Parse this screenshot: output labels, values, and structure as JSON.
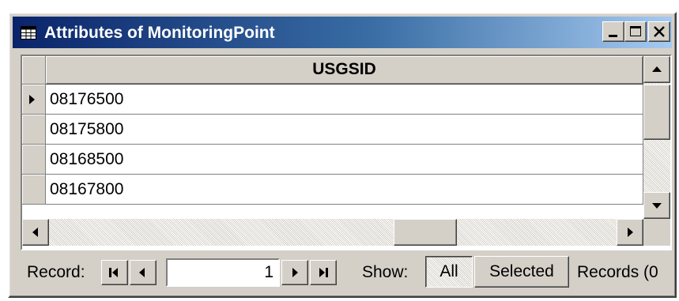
{
  "window": {
    "title": "Attributes of MonitoringPoint",
    "icon": "table-icon",
    "controls": {
      "minimize_icon": "minimize-icon",
      "maximize_icon": "maximize-icon",
      "close_icon": "close-icon"
    }
  },
  "table": {
    "column_header": "USGSID",
    "rows": [
      "08176500",
      "08175800",
      "08168500",
      "08167800"
    ],
    "current_row_icon": "row-pointer-icon"
  },
  "statusbar": {
    "record_label": "Record:",
    "record_value": "1",
    "first_icon": "first-record-icon",
    "prev_icon": "previous-record-icon",
    "next_icon": "next-record-icon",
    "last_icon": "last-record-icon",
    "show_label": "Show:",
    "all_label": "All",
    "selected_label": "Selected",
    "records_label": "Records (0"
  },
  "colors": {
    "titlebar_start": "#0a246a",
    "titlebar_end": "#a6caf0",
    "face": "#d4d0c8"
  }
}
